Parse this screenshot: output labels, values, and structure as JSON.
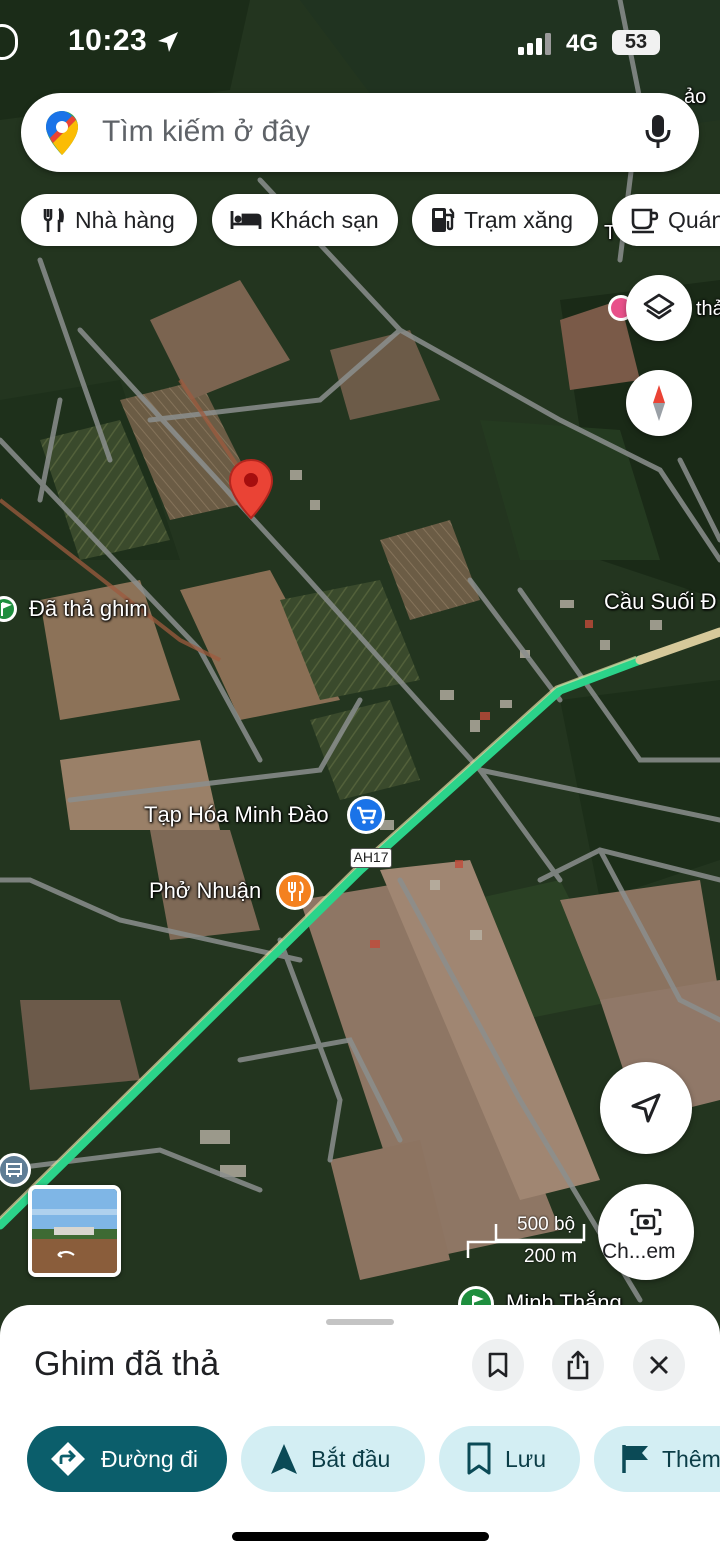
{
  "status_bar": {
    "time": "10:23",
    "network": "4G",
    "battery": "53"
  },
  "search": {
    "placeholder": "Tìm kiếm ở đây"
  },
  "chips": [
    {
      "label": "Nhà hàng",
      "icon": "restaurant-icon"
    },
    {
      "label": "Khách sạn",
      "icon": "hotel-icon"
    },
    {
      "label": "Trạm xăng",
      "icon": "gas-station-icon"
    },
    {
      "label": "Quán",
      "icon": "coffee-icon"
    }
  ],
  "map_labels": {
    "dropped_pin": "Đã thả ghim",
    "bridge": "Cầu Suối Đ",
    "store": "Tạp Hóa Minh Đào",
    "restaurant": "Phở Nhuận",
    "highway": "AH17",
    "place_bottom": "Minh Thắng",
    "top_right_a": "ảo",
    "top_right_b": "thả",
    "top_right_c": "T"
  },
  "scale": {
    "imperial": "500 bộ",
    "metric": "200 m"
  },
  "lens": {
    "label": "Ch...em"
  },
  "sheet": {
    "title": "Ghim đã thả",
    "actions": [
      {
        "label": "Đường đi",
        "icon": "directions-icon"
      },
      {
        "label": "Bắt đầu",
        "icon": "navigation-arrow-icon"
      },
      {
        "label": "Lưu",
        "icon": "bookmark-icon"
      },
      {
        "label": "Thêm",
        "icon": "flag-icon"
      }
    ]
  },
  "colors": {
    "route": "#2bd38a",
    "pin": "#ea4335",
    "primary": "#0b5e6b",
    "tonal": "#d3eef3",
    "accent_blue": "#1a73e8",
    "food_orange": "#f4811f"
  }
}
